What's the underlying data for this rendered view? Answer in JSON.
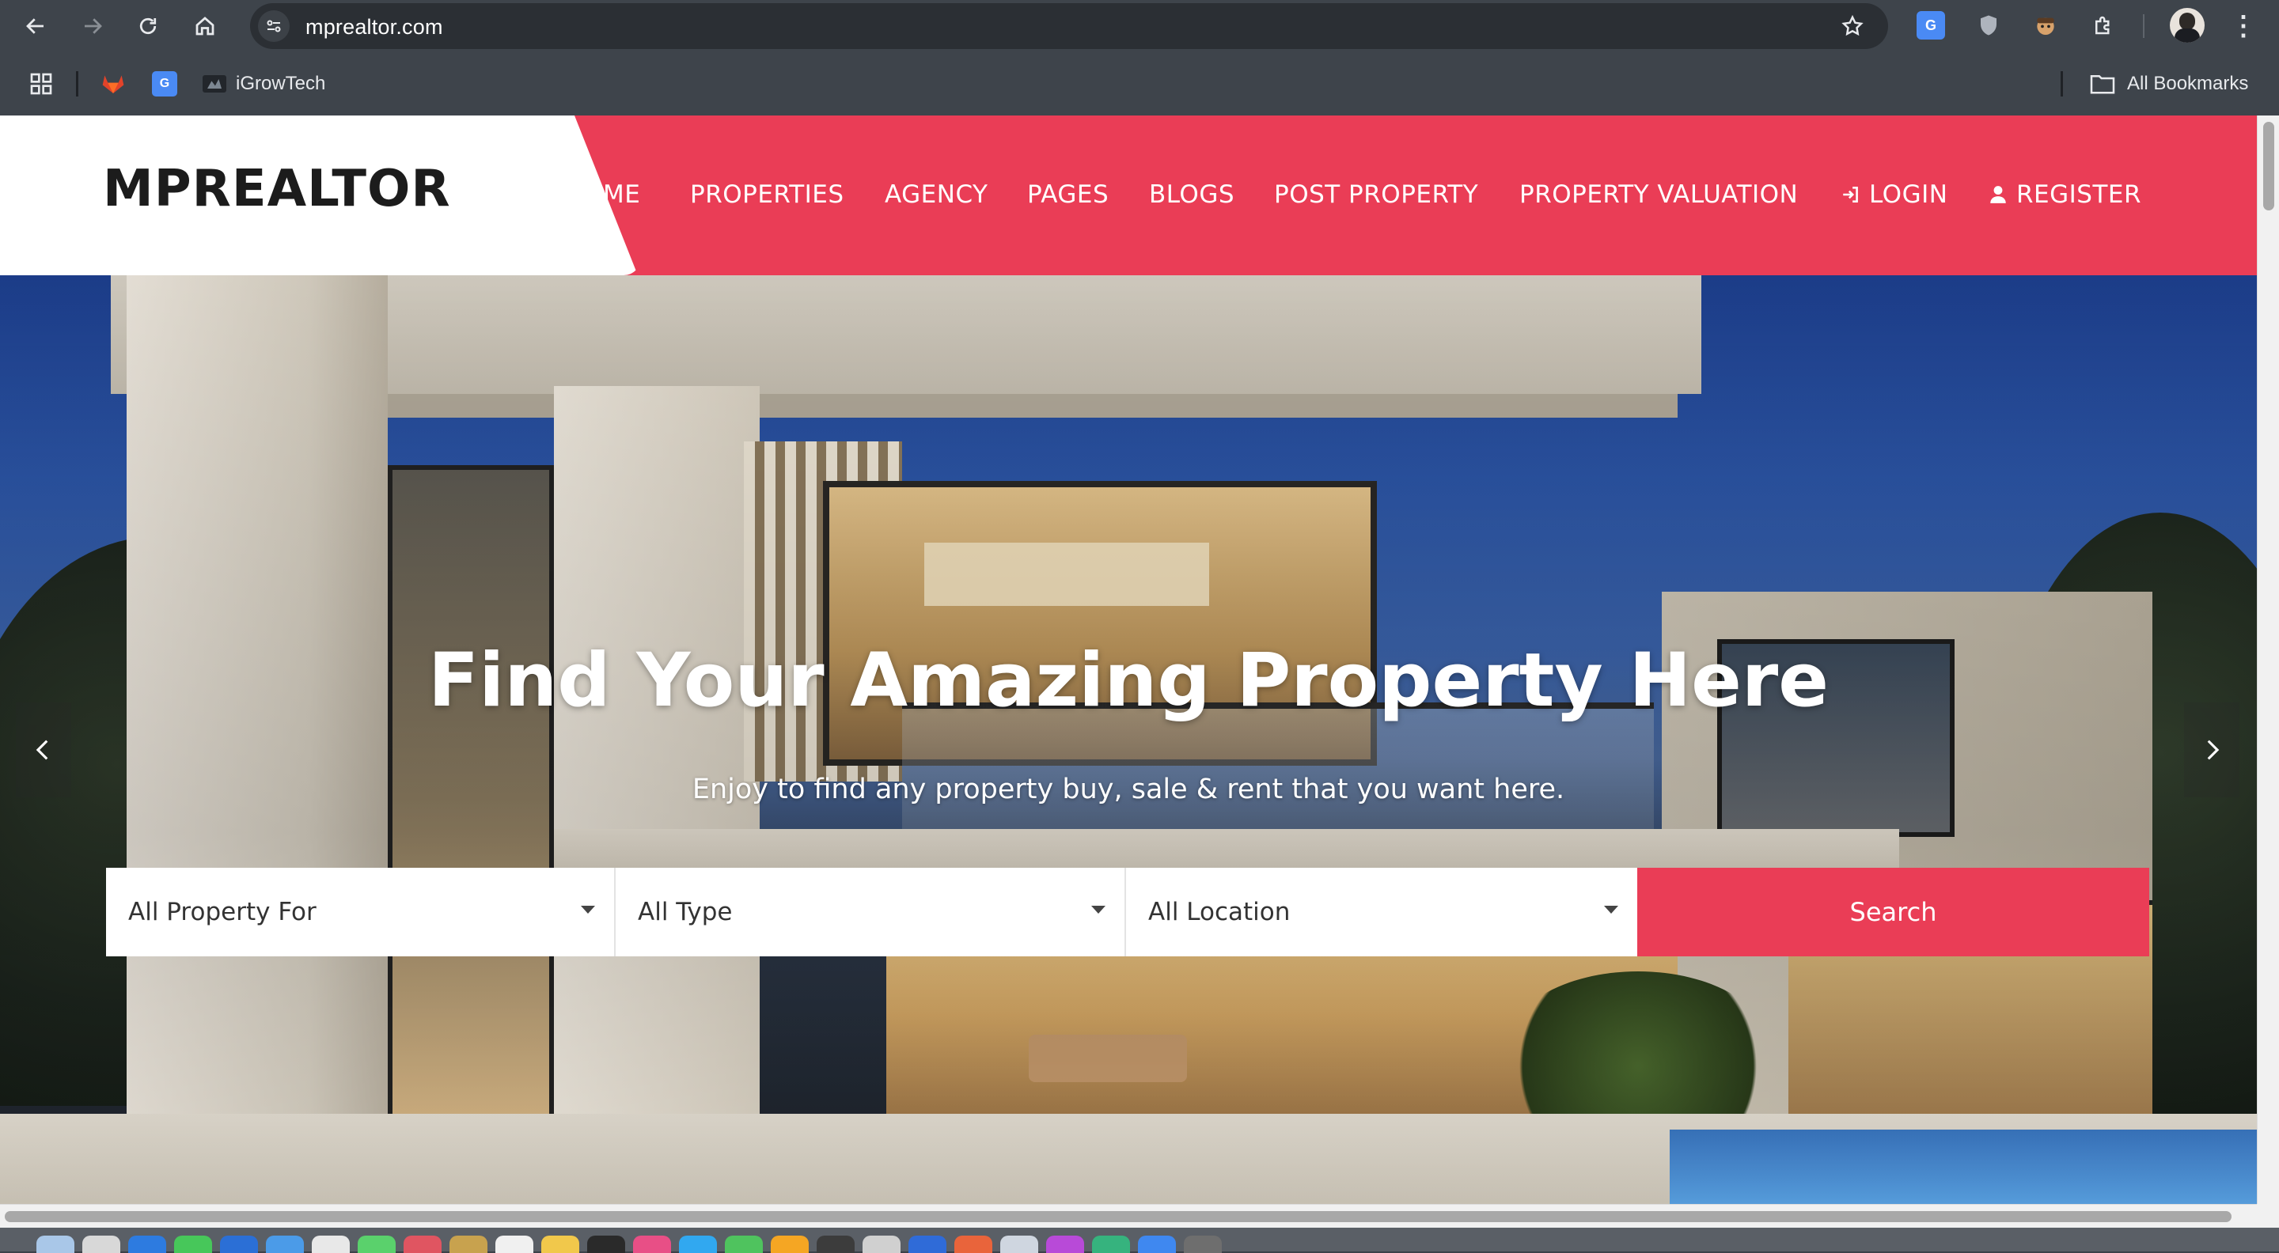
{
  "browser": {
    "url": "mprealtor.com",
    "bookmarks": [
      {
        "label": "iGrowTech"
      }
    ],
    "all_bookmarks_label": "All Bookmarks"
  },
  "site": {
    "logo": "MPREALTOR",
    "nav": [
      {
        "label": "HOME",
        "visible_text": "ME"
      },
      {
        "label": "PROPERTIES"
      },
      {
        "label": "AGENCY"
      },
      {
        "label": "PAGES"
      },
      {
        "label": "BLOGS"
      },
      {
        "label": "POST PROPERTY"
      },
      {
        "label": "PROPERTY VALUATION"
      },
      {
        "label": "LOGIN",
        "icon": "sign-in-icon"
      },
      {
        "label": "REGISTER",
        "icon": "user-icon"
      }
    ],
    "accent_color": "#ea3d56"
  },
  "hero": {
    "title": "Find Your Amazing Property Here",
    "subtitle": "Enjoy to find any property buy, sale & rent that you want here.",
    "search": {
      "property_for": "All Property For",
      "type": "All Type",
      "location": "All Location",
      "button": "Search"
    }
  }
}
